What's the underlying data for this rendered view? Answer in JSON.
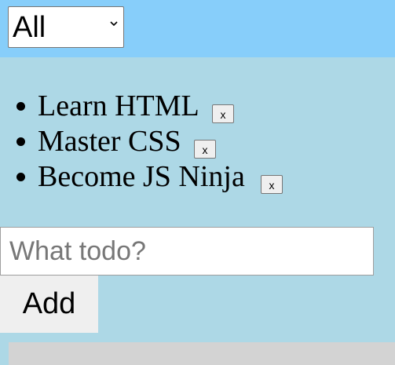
{
  "filter": {
    "selected": "All",
    "icon": "chevron-down-icon"
  },
  "todos": [
    {
      "text": "Learn HTML",
      "delete_label": "x"
    },
    {
      "text": "Master CSS",
      "delete_label": "x"
    },
    {
      "text": "Become JS Ninja",
      "delete_label": "x"
    }
  ],
  "new_todo": {
    "value": "",
    "placeholder": "What todo?"
  },
  "add_button": {
    "label": "Add"
  },
  "colors": {
    "header_bg": "#87CEFA",
    "page_bg": "#ADD8E6",
    "footer_bg": "#D3D3D3",
    "button_bg": "#EFEFEF"
  }
}
